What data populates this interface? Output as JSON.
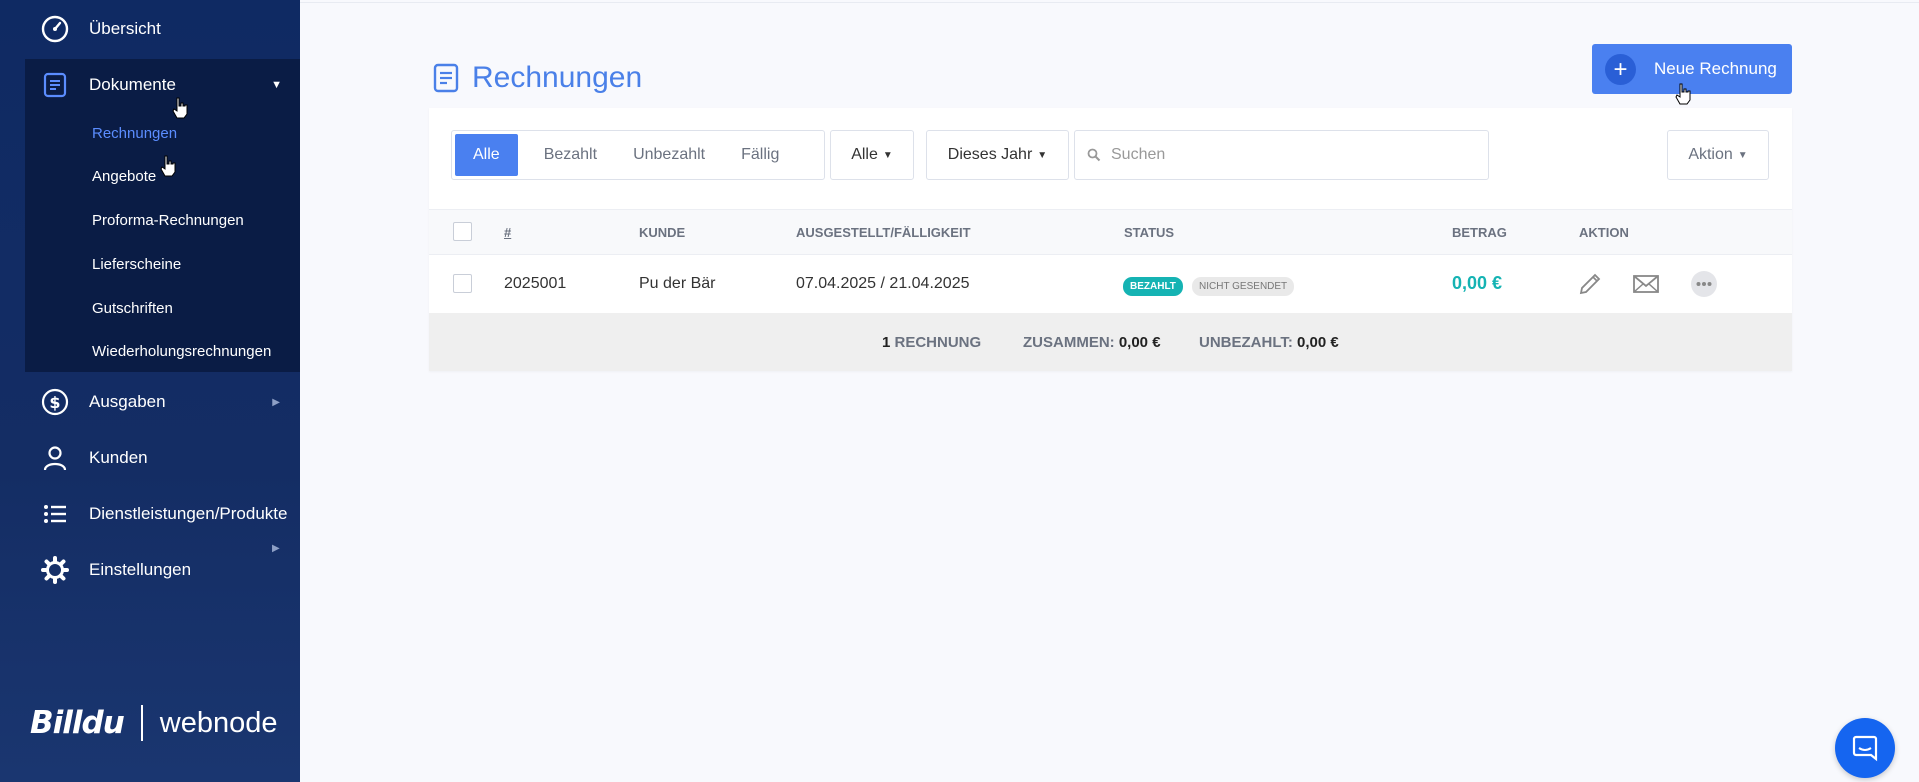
{
  "sidebar": {
    "items": [
      {
        "label": "Übersicht",
        "icon": "dashboard-icon"
      },
      {
        "label": "Dokumente",
        "icon": "document-icon"
      },
      {
        "label": "Ausgaben",
        "icon": "dollar-icon"
      },
      {
        "label": "Kunden",
        "icon": "user-icon"
      },
      {
        "label": "Dienstleistungen/Produkte",
        "icon": "list-icon"
      },
      {
        "label": "Einstellungen",
        "icon": "gear-icon"
      }
    ],
    "documents_sub": [
      {
        "label": "Rechnungen",
        "active": true
      },
      {
        "label": "Angebote"
      },
      {
        "label": "Proforma-Rechnungen"
      },
      {
        "label": "Lieferscheine"
      },
      {
        "label": "Gutschriften"
      },
      {
        "label": "Wiederholungsrechnungen"
      }
    ],
    "brand": {
      "left": "Billdu",
      "right": "webnode"
    }
  },
  "page": {
    "title": "Rechnungen",
    "new_button": "Neue Rechnung"
  },
  "filters": {
    "status_tabs": [
      "Alle",
      "Bezahlt",
      "Unbezahlt",
      "Fällig"
    ],
    "type_select": "Alle",
    "period_select": "Dieses Jahr",
    "search_placeholder": "Suchen",
    "action_button": "Aktion"
  },
  "table": {
    "columns": [
      "#",
      "KUNDE",
      "AUSGESTELLT/FÄLLIGKEIT",
      "STATUS",
      "BETRAG",
      "AKTION"
    ],
    "rows": [
      {
        "number": "2025001",
        "customer": "Pu der Bär",
        "dates": "07.04.2025 / 21.04.2025",
        "status_paid": "BEZAHLT",
        "status_sent": "NICHT GESENDET",
        "amount": "0,00 €"
      }
    ],
    "footer": {
      "count": "1",
      "count_label": "RECHNUNG",
      "total_label": "ZUSAMMEN:",
      "total_value": "0,00 €",
      "unpaid_label": "UNBEZAHLT:",
      "unpaid_value": "0,00 €"
    }
  },
  "colors": {
    "sidebar_bg": "#0f2a63",
    "accent": "#4a80f0",
    "paid_badge": "#15b3b3",
    "amount": "#15b3b3"
  }
}
